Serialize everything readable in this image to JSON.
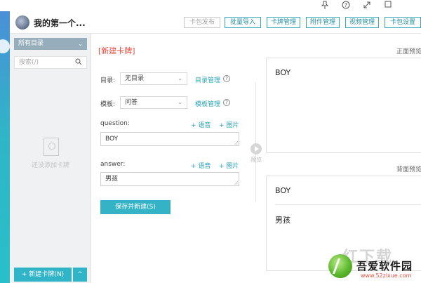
{
  "window": {
    "pin_icon": "pin-icon",
    "help_icon": "help-icon",
    "expand_icon": "expand-icon",
    "maximize_icon": "maximize-icon"
  },
  "header": {
    "app_name": "我的第一个...",
    "buttons": {
      "publish": "卡包发布",
      "import": "批量导入",
      "cards": "卡牌管理",
      "attachments": "附件管理",
      "videos": "视频管理",
      "settings": "卡包设置"
    }
  },
  "sidebar": {
    "directory_label": "所有目录",
    "search_placeholder": "搜索(/)",
    "empty_text": "还没添加卡牌",
    "new_card_label": "+ 新建卡牌(N)",
    "toggle_label": "^"
  },
  "form": {
    "title": "[新建卡牌]",
    "directory": {
      "label": "目录:",
      "value": "无目录",
      "manage_link": "目录管理"
    },
    "template": {
      "label": "模板:",
      "value": "问答",
      "manage_link": "模板管理"
    },
    "question": {
      "label": "question:",
      "voice_link": "+ 语音",
      "image_link": "+ 图片",
      "value": "BOY"
    },
    "answer": {
      "label": "answer:",
      "voice_link": "+ 语音",
      "image_link": "+ 图片",
      "value": "男孩"
    },
    "save_label": "保存并新建(S)"
  },
  "preview": {
    "label": "预览",
    "front_title": "正面预览",
    "back_title": "背面预览",
    "front_text": "BOY",
    "back_question": "BOY",
    "back_answer": "男孩"
  },
  "watermark": {
    "big": "红下载",
    "site_name": "吾爱软件园",
    "url": "www.52zixue.com"
  },
  "colors": {
    "accent": "#2fb5c7",
    "title_red": "#e84b3c",
    "sidebar_dir": "#96aebc"
  }
}
